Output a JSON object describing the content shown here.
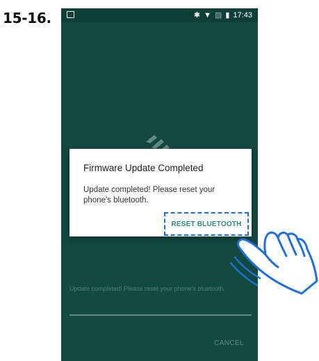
{
  "step_label": "15-16.",
  "status_bar": {
    "time": "17:43",
    "icons": [
      "image-notification-icon",
      "bluetooth-icon",
      "wifi-icon",
      "no-sim-icon",
      "battery-icon"
    ]
  },
  "background": {
    "message": "Update completed! Please reset your phone's bluetooth.",
    "cancel_label": "CANCEL"
  },
  "dialog": {
    "title": "Firmware Update Completed",
    "message": "Update completed! Please reset your phone's bluetooth.",
    "button_label": "RESET BLUETOOTH"
  },
  "colors": {
    "app_background": "#124a40",
    "status_bar": "#0e3f36",
    "accent_teal": "#2a8c7d",
    "highlight_blue": "#1e6fd9"
  }
}
